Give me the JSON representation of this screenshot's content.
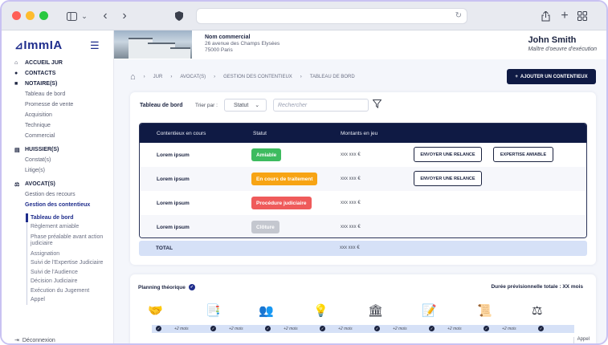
{
  "browser": {
    "dots": [
      "close",
      "minimize",
      "maximize"
    ],
    "icons": [
      "sidebar-toggle-icon",
      "chevron-down-icon",
      "back-arrow-icon",
      "forward-arrow-icon",
      "shield-icon",
      "reload-icon",
      "share-icon",
      "plus-icon",
      "tabs-grid-icon"
    ]
  },
  "sidebar": {
    "logo": "ImmIA",
    "sections": [
      {
        "label": "ACCUEIL JUR",
        "icon": "home-icon"
      },
      {
        "label": "CONTACTS",
        "icon": "user-icon"
      },
      {
        "label": "NOTAIRE(S)",
        "icon": "briefcase-icon",
        "items": [
          "Tableau de bord",
          "Promesse de vente",
          "Acquisition",
          "Technique",
          "Commercial"
        ]
      },
      {
        "label": "HUISSIER(S)",
        "icon": "document-icon",
        "items": [
          "Constat(s)",
          "Litige(s)"
        ]
      },
      {
        "label": "AVOCAT(S)",
        "icon": "scale-icon",
        "items": [
          "Gestion des recours",
          "Gestion des contentieux"
        ]
      }
    ],
    "contentieux_items": [
      "Tableau de bord",
      "Règlement amiable",
      "Phase préalable avant action judiciaire",
      "Assignation",
      "Suivi de l'Expertise Judiciaire",
      "Suivi de l'Audience",
      "Décision Judiciaire",
      "Exécution du Jugement",
      "Appel"
    ],
    "logout": "Déconnexion"
  },
  "header": {
    "company_name": "Nom commercial",
    "address_line1": "26 avenue des Champs Elysées",
    "address_line2": "75000 Paris",
    "user_name": "John Smith",
    "user_role": "Maître d'oeuvre d'exécution"
  },
  "breadcrumb": [
    "JUR",
    "AVOCAT(S)",
    "GESTION DES CONTENTIEUX",
    "TABLEAU DE BORD"
  ],
  "add_button": "AJOUTER UN CONTENTIEUX",
  "dashboard": {
    "title": "Tableau de bord",
    "sort_label": "Trier par :",
    "sort_value": "Statut",
    "search_placeholder": "Rechercher",
    "columns": [
      "Contentieux en cours",
      "Statut",
      "Montants en jeu"
    ],
    "rows": [
      {
        "name": "Lorem ipsum",
        "status": "Amiable",
        "color": "#3dbb5f",
        "amount": "xxx xxx €",
        "actions": [
          "ENVOYER UNE RELANCE",
          "EXPERTISE AMIABLE"
        ]
      },
      {
        "name": "Lorem ipsum",
        "status": "En cours de traitement",
        "color": "#f7a414",
        "amount": "xxx xxx €",
        "actions": [
          "ENVOYER UNE RELANCE"
        ]
      },
      {
        "name": "Lorem ipsum",
        "status": "Procédure judiciaire",
        "color": "#ef5b5b",
        "amount": "xxx xxx €",
        "actions": []
      },
      {
        "name": "Lorem ipsum",
        "status": "Clôture",
        "color": "#c4c7cf",
        "amount": "xxx xxx €",
        "actions": []
      }
    ],
    "total_label": "TOTAL",
    "total_amount": "xxx xxx €"
  },
  "planning": {
    "title": "Planning théorique",
    "duration": "Durée prévisionnelle totale : XX mois",
    "step_label": "+2 mois",
    "step_icons": [
      "handshake-icon",
      "documents-icon",
      "people-icon",
      "lightbulb-icon",
      "courthouse-icon",
      "contract-icon",
      "certificate-icon",
      "gavel-icon"
    ],
    "last_label": "Appel"
  }
}
